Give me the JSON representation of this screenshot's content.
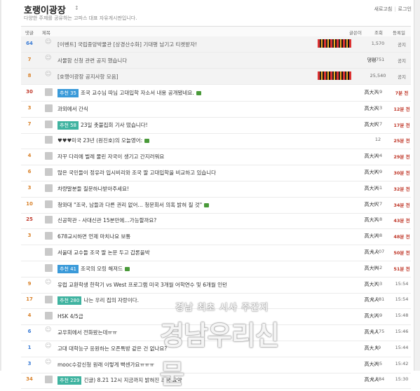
{
  "header": {
    "title": "호랭이광장",
    "arrow": "↕",
    "description": "다양한 주제를 공유하는 고파스 대표 자유게시판입니다.",
    "links": [
      "새로고침",
      "로그인"
    ]
  },
  "columns": {
    "count": "댓글",
    "subject": "제목",
    "author": "글쓴이",
    "views": "조회",
    "date": "등록일"
  },
  "rows": [
    {
      "count": "64",
      "color": "blue",
      "avatar": "people",
      "badge": "",
      "subject": "[이벤트] 국립중앙박물관 [상경산수화] 기대평 남기고 티켓받자!",
      "img": false,
      "author": "",
      "banner": true,
      "views": "1,570",
      "date": "공지",
      "notice": true
    },
    {
      "count": "7",
      "color": "orange",
      "avatar": "people",
      "badge": "",
      "subject": "사물함 신청 관련 공지 했습니다",
      "img": false,
      "author": "댕댕",
      "banner": false,
      "views": "2,751",
      "date": "공지",
      "notice": true
    },
    {
      "count": "8",
      "color": "orange",
      "avatar": "people",
      "badge": "",
      "subject": "[호랭이광장 공지사항 모음]",
      "img": false,
      "author": "",
      "banner": true,
      "views": "25,540",
      "date": "공지",
      "notice": true
    },
    {
      "count": "30",
      "color": "red",
      "avatar": "box",
      "badge": "추천 35",
      "badgeColor": "blue",
      "subject": "조국 교수님 따님 고대입학 자소서 내용 공개됐네요.",
      "img": true,
      "author": "高大人",
      "views": "719",
      "date": "7분 전",
      "red": true
    },
    {
      "count": "3",
      "color": "orange",
      "avatar": "box",
      "badge": "",
      "subject": "과외에서 간식",
      "img": false,
      "author": "高大人",
      "views": "223",
      "date": "12분 전",
      "red": true
    },
    {
      "count": "7",
      "color": "orange",
      "avatar": "box",
      "badge": "추천 58",
      "badgeColor": "teal",
      "subject": "23일 촛불집회 기사 떴습니다!",
      "img": false,
      "author": "高大人",
      "views": "877",
      "date": "17분 전",
      "red": true
    },
    {
      "count": "",
      "color": "orange",
      "avatar": "box",
      "badge": "",
      "subject": "♥♥♥미국 23년 (원진호)의 오늘영어:",
      "img": true,
      "author": "",
      "views": "12",
      "date": "25분 전",
      "red": true
    },
    {
      "count": "4",
      "color": "orange",
      "avatar": "box",
      "badge": "",
      "subject": "자꾸 다리에 벌레 물린 자국이 생기고 간지러워요",
      "img": false,
      "author": "高大人",
      "views": "194",
      "date": "29분 전",
      "red": true
    },
    {
      "count": "6",
      "color": "orange",
      "avatar": "box",
      "badge": "",
      "subject": "많은 국민들이 정유라 입시비리와 조국 딸 고대입학을 비교하고 있습니다",
      "img": false,
      "author": "高大人",
      "views": "909",
      "date": "30분 전",
      "red": true
    },
    {
      "count": "3",
      "color": "orange",
      "avatar": "box",
      "badge": "",
      "subject": "차량말분들 질문하나받아주세요!",
      "img": false,
      "author": "高大人",
      "views": "161",
      "date": "32분 전",
      "red": true
    },
    {
      "count": "10",
      "color": "orange",
      "avatar": "box",
      "badge": "",
      "subject": "청와대 \"조국, 남들과 다른 권리 없어… 청문회서 의혹 밝혀 질 것\"",
      "img": true,
      "author": "高大人",
      "views": "677",
      "date": "34분 전",
      "red": true
    },
    {
      "count": "25",
      "color": "red",
      "avatar": "box",
      "badge": "",
      "subject": "신공학관 - 사대신관 15분만에…가능할까요?",
      "img": false,
      "author": "高大人",
      "views": "318",
      "date": "43분 전",
      "red": true
    },
    {
      "count": "3",
      "color": "orange",
      "avatar": "box",
      "badge": "",
      "subject": "678교시하면 언제 마치나요 보통",
      "img": false,
      "author": "高大人",
      "views": "188",
      "date": "48분 전",
      "red": true
    },
    {
      "count": "",
      "color": "orange",
      "avatar": "box",
      "badge": "",
      "subject": "서울대 교수들 조국 딸 논문 두고 갑론을박",
      "img": false,
      "author": "高大人",
      "views": "1,007",
      "date": "50분 전",
      "red": true
    },
    {
      "count": "",
      "color": "orange",
      "avatar": "box",
      "badge": "추천 41",
      "badgeColor": "blue",
      "subject": "조국의 오링 해져드",
      "img": true,
      "author": "高大人",
      "views": "842",
      "date": "51분 전",
      "red": true
    },
    {
      "count": "9",
      "color": "orange",
      "avatar": "people",
      "badge": "",
      "subject": "유럽 교환학생 한학기 vs West 프로그램 미국 3개월 어학연수 및 6개월 인턴",
      "img": false,
      "author": "高大人",
      "views": "303",
      "date": "15:54",
      "red": false
    },
    {
      "count": "17",
      "color": "orange",
      "avatar": "box",
      "badge": "추천 280",
      "badgeColor": "teal",
      "subject": "나는 우리 집의 자랑이다.",
      "img": false,
      "author": "高大人",
      "views": "2,081",
      "date": "15:54",
      "red": false
    },
    {
      "count": "4",
      "color": "orange",
      "avatar": "box",
      "badge": "",
      "subject": "HSK 4/5급",
      "img": false,
      "author": "高大人",
      "views": "169",
      "date": "15:48",
      "red": false
    },
    {
      "count": "6",
      "color": "blue",
      "avatar": "people",
      "badge": "",
      "subject": "교우회에서 전화왔는데ㅠㅠ",
      "img": false,
      "author": "高大人",
      "views": "1,175",
      "date": "15:46",
      "red": false
    },
    {
      "count": "1",
      "color": "blue",
      "avatar": "people",
      "badge": "",
      "subject": "고대 대학능구 응원하는 오픈톡방 같은 건 없나요?",
      "img": false,
      "author": "高大人",
      "views": "99",
      "date": "15:44",
      "red": false
    },
    {
      "count": "3",
      "color": "blue",
      "avatar": "people",
      "badge": "",
      "subject": "mooc수강신청 원래 이렇게 빡센가요ㅠㅠㅠ",
      "img": false,
      "author": "高大人",
      "views": "285",
      "date": "15:42",
      "red": false
    },
    {
      "count": "34",
      "color": "orange",
      "avatar": "box",
      "badge": "추천 229",
      "badgeColor": "teal",
      "subject": "긴글) 8.21 12시 지금까지 밝혀진 조국 요약",
      "img": false,
      "author": "高大人",
      "views": "2,384",
      "date": "15:30",
      "red": false
    }
  ],
  "watermark": {
    "line1": "경남 최초 시사 주간지",
    "line2": "경남우리신문"
  }
}
